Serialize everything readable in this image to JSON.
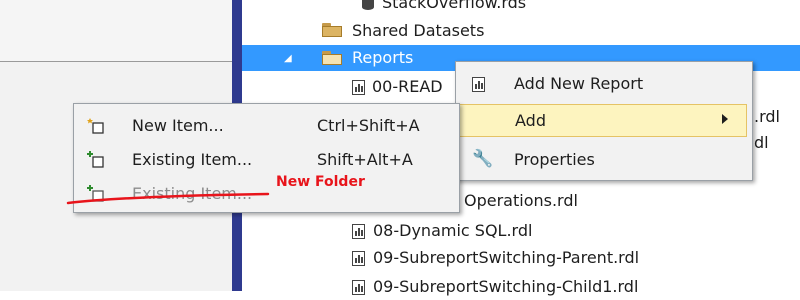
{
  "tree": {
    "items": [
      {
        "label": "StackOverflow.rds"
      },
      {
        "label": "Shared Datasets"
      },
      {
        "label": "Reports"
      },
      {
        "label": "00-READ"
      },
      {
        "label": ".rdl"
      },
      {
        "label": "dl"
      },
      {
        "label": "Operations.rdl"
      },
      {
        "label": "08-Dynamic SQL.rdl"
      },
      {
        "label": "09-SubreportSwitching-Parent.rdl"
      },
      {
        "label": "09-SubreportSwitching-Child1.rdl"
      }
    ]
  },
  "context_menu": {
    "items": [
      {
        "label": "Add New Report"
      },
      {
        "label": "Add"
      },
      {
        "label": "Properties"
      }
    ]
  },
  "add_submenu": {
    "items": [
      {
        "label": "New Item...",
        "shortcut": "Ctrl+Shift+A"
      },
      {
        "label": "Existing Item...",
        "shortcut": "Shift+Alt+A"
      },
      {
        "label": "Existing Item..."
      }
    ]
  },
  "annotation": {
    "text": "New Folder",
    "color": "#e8141b"
  },
  "colors": {
    "selection": "#3399ff",
    "menu_highlight": "#fdf4bf",
    "splitter": "#2f3a8f"
  }
}
